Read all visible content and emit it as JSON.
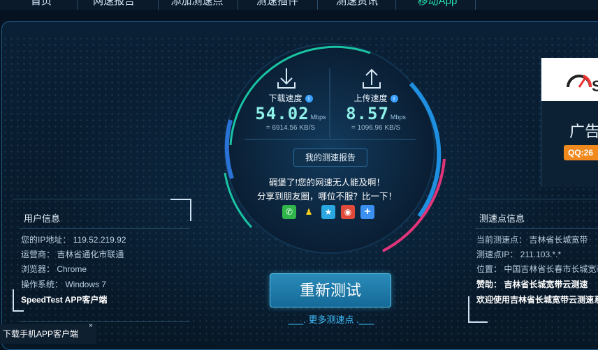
{
  "nav": {
    "items": [
      "首页",
      "网速报告",
      "添加测速点",
      "测速插件",
      "测速资讯",
      "移动App"
    ]
  },
  "download": {
    "title": "下载速度",
    "info_icon": "i",
    "value": "54.02",
    "unit": "Mbps",
    "sub": "= 6914.56  KB/S"
  },
  "upload": {
    "title": "上传速度",
    "info_icon": "i",
    "value": "8.57",
    "unit": "Mbps",
    "sub": "= 1096.96  KB/S"
  },
  "report_button": "我的测速报告",
  "brag": {
    "line1": "碉堡了!您的网速无人能及啊！",
    "line2": "分享到朋友圈，哪位不服？比一下！"
  },
  "share_icons": [
    "wechat-icon",
    "qq-icon",
    "qzone-icon",
    "weibo-icon",
    "more-share-icon"
  ],
  "retest_button": "重新测试",
  "more_points": "___. 更多测速点 .___",
  "user_info": {
    "title": "用户信息",
    "rows": [
      "您的IP地址：  119.52.219.92",
      "运营商：  吉林省通化市联通",
      "浏览器：  Chrome",
      "操作系统：  Windows 7",
      "SpeedTest APP客户端"
    ]
  },
  "server_info": {
    "title": "测速点信息",
    "rows": [
      "当前测速点：  吉林省长城宽带",
      "测速点IP：  211.103.*.*",
      "位置：  中国吉林省长春市长城宽带",
      "赞助：  吉林省长城宽带云测速",
      "欢迎使用吉林省长城宽带云测速系"
    ]
  },
  "ad": {
    "word": "广告",
    "qq": "QQ:26"
  },
  "download_app": {
    "label": "下载手机APP客户端",
    "close": "×"
  },
  "colors": {
    "accent_cyan": "#27e0b0",
    "speed_text": "#8ff0e8",
    "arc_blue": "#1f8fe0",
    "arc_pink": "#e0357a",
    "link_blue": "#3fc0ff"
  }
}
